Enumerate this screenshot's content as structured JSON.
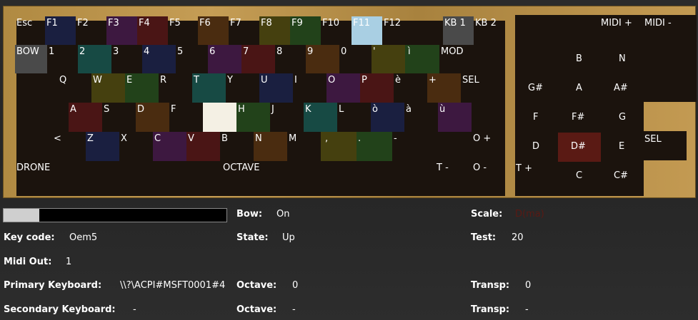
{
  "colors": {
    "navy": "#1a1f40",
    "purple": "#3d1840",
    "maroon": "#4a1515",
    "brown": "#4a2c10",
    "olive": "#45400f",
    "green": "#22421a",
    "teal": "#174a44",
    "gray": "#4a4a4a",
    "lightblue": "#a9cfe3",
    "white": "#f4f0e4",
    "red_sel": "#5a1a14"
  },
  "keys_top": {
    "esc": "Esc",
    "f1": "F1",
    "f2": "F2",
    "f3": "F3",
    "f4": "F4",
    "f5": "F5",
    "f6": "F6",
    "f7": "F7",
    "f8": "F8",
    "f9": "F9",
    "f10": "F10",
    "f11": "F11",
    "f12": "F12",
    "kb1": "KB 1",
    "kb2": "KB 2"
  },
  "keys_row1": {
    "bow": "BOW",
    "k1": "1",
    "k2": "2",
    "k3": "3",
    "k4": "4",
    "k5": "5",
    "k6": "6",
    "k7": "7",
    "k8": "8",
    "k9": "9",
    "k0": "0",
    "apos": "'",
    "igrave": "ì",
    "mod": "MOD"
  },
  "keys_row2": {
    "q": "Q",
    "w": "W",
    "e": "E",
    "r": "R",
    "t": "T",
    "y": "Y",
    "u": "U",
    "i": "I",
    "o": "O",
    "p": "P",
    "egrave": "è",
    "plus": "+",
    "sel": "SEL"
  },
  "keys_row3": {
    "a": "A",
    "s": "S",
    "d": "D",
    "f": "F",
    "h": "H",
    "j": "J",
    "k": "K",
    "l": "L",
    "ograve": "ò",
    "agrave": "à",
    "ugrave": "ù"
  },
  "keys_row4": {
    "lt": "<",
    "z": "Z",
    "x": "X",
    "c": "C",
    "v": "V",
    "b": "B",
    "n": "N",
    "m": "M",
    "comma": ",",
    "dot": ".",
    "dash": "-",
    "oplus": "O +"
  },
  "keys_row5": {
    "drone": "DRONE",
    "octave": "OCTAVE",
    "tminus": "T -",
    "ominus": "O -"
  },
  "midi_panel": {
    "midi_plus": "MIDI +",
    "midi_minus": "MIDI -",
    "notes": {
      "b": "B",
      "n": "N",
      "gsharp": "G#",
      "a": "A",
      "asharp": "A#",
      "f": "F",
      "fsharp": "F#",
      "g": "G",
      "d": "D",
      "dsharp": "D#",
      "e": "E",
      "c": "C",
      "csharp": "C#"
    },
    "tplus": "T +",
    "sel": "SEL"
  },
  "status": {
    "progress_fraction": 0.16,
    "bow_label": "Bow:",
    "bow_value": "On",
    "scale_label": "Scale:",
    "scale_value": "D(ma)",
    "keycode_label": "Key code:",
    "keycode_value": "Oem5",
    "state_label": "State:",
    "state_value": "Up",
    "test_label": "Test:",
    "test_value": "20",
    "midiout_label": "Midi Out:",
    "midiout_value": "1",
    "primary_label": "Primary Keyboard:",
    "primary_value": "\\\\?\\ACPI#MSFT0001#4",
    "octave1_label": "Octave:",
    "octave1_value": "0",
    "transp1_label": "Transp:",
    "transp1_value": "0",
    "secondary_label": "Secondary Keyboard:",
    "secondary_value": "-",
    "octave2_label": "Octave:",
    "octave2_value": "-",
    "transp2_label": "Transp:",
    "transp2_value": "-"
  }
}
